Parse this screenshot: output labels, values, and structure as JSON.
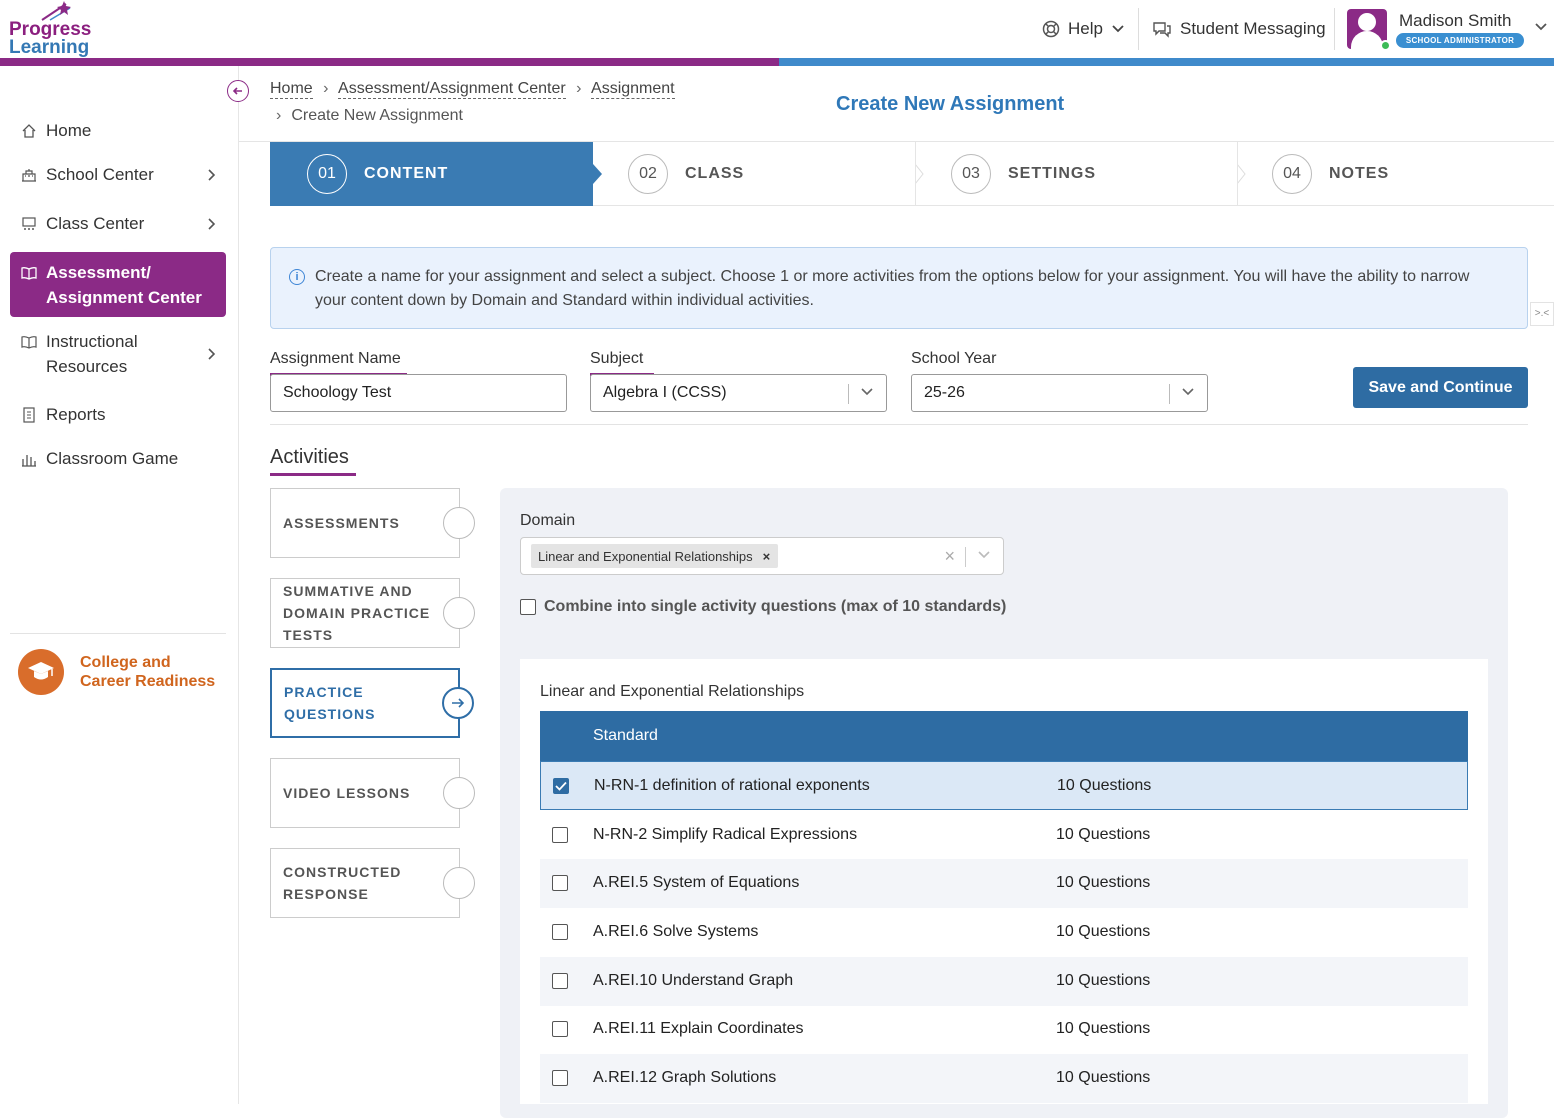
{
  "app": {
    "logo_line1": "Progress",
    "logo_line2": "Learning"
  },
  "header": {
    "help_label": "Help",
    "messaging_label": "Student Messaging",
    "user_name": "Madison Smith",
    "user_role": "SCHOOL ADMINISTRATOR"
  },
  "sidebar": {
    "items": [
      {
        "label": "Home",
        "icon": "home-icon"
      },
      {
        "label": "School Center",
        "icon": "school-icon"
      },
      {
        "label": "Class Center",
        "icon": "class-icon"
      },
      {
        "label": "Assessment/ Assignment Center",
        "line1": "Assessment/",
        "line2": "Assignment Center",
        "icon": "book-icon",
        "active": true
      },
      {
        "label": "Instructional Resources",
        "line1": "Instructional",
        "line2": "Resources",
        "icon": "book-open-icon"
      },
      {
        "label": "Reports",
        "icon": "report-icon"
      },
      {
        "label": "Classroom Game",
        "icon": "game-icon"
      }
    ],
    "ccr_line1": "College and",
    "ccr_line2": "Career Readiness"
  },
  "breadcrumb": {
    "items": [
      "Home",
      "Assessment/Assignment Center",
      "Assignment"
    ],
    "current": "Create New Assignment"
  },
  "page_title": "Create New Assignment",
  "steps": [
    {
      "num": "01",
      "label": "CONTENT",
      "active": true
    },
    {
      "num": "02",
      "label": "CLASS"
    },
    {
      "num": "03",
      "label": "SETTINGS"
    },
    {
      "num": "04",
      "label": "NOTES"
    }
  ],
  "info_text_line1": "Create a name for your assignment and select a subject. Choose 1 or more activities from the options below for your assignment. You will have the ability to narrow",
  "info_text_line2": "your content down by Domain and Standard within individual activities.",
  "form": {
    "name_label": "Assignment Name",
    "name_value": "Schoology Test",
    "subject_label": "Subject",
    "subject_value": "Algebra I (CCSS)",
    "year_label": "School Year",
    "year_value": "25-26",
    "save_label": "Save and Continue"
  },
  "activities": {
    "title": "Activities",
    "items": [
      {
        "label": "ASSESSMENTS"
      },
      {
        "line1": "SUMMATIVE AND",
        "line2": "DOMAIN PRACTICE",
        "line3": "TESTS"
      },
      {
        "line1": "PRACTICE",
        "line2": "QUESTIONS",
        "active": true
      },
      {
        "label": "VIDEO LESSONS"
      },
      {
        "line1": "CONSTRUCTED",
        "line2": "RESPONSE"
      }
    ]
  },
  "domain": {
    "label": "Domain",
    "selected_tag": "Linear and Exponential Relationships",
    "combine_label": "Combine into single activity questions (max of 10 standards)"
  },
  "standards": {
    "caption": "Linear and Exponential Relationships",
    "header": "Standard",
    "rows": [
      {
        "name": "N-RN-1 definition of rational exponents",
        "count": "10 Questions",
        "checked": true
      },
      {
        "name": "N-RN-2 Simplify Radical Expressions",
        "count": "10 Questions",
        "checked": false
      },
      {
        "name": "A.REI.5 System of Equations",
        "count": "10 Questions",
        "checked": false
      },
      {
        "name": "A.REI.6 Solve Systems",
        "count": "10 Questions",
        "checked": false
      },
      {
        "name": "A.REI.10 Understand Graph",
        "count": "10 Questions",
        "checked": false
      },
      {
        "name": "A.REI.11 Explain Coordinates",
        "count": "10 Questions",
        "checked": false
      },
      {
        "name": "A.REI.12 Graph Solutions",
        "count": "10 Questions",
        "checked": false
      }
    ]
  },
  "colors": {
    "brand_purple": "#8b2a86",
    "brand_blue": "#2e6ca3",
    "accent_orange": "#d96d2b"
  }
}
